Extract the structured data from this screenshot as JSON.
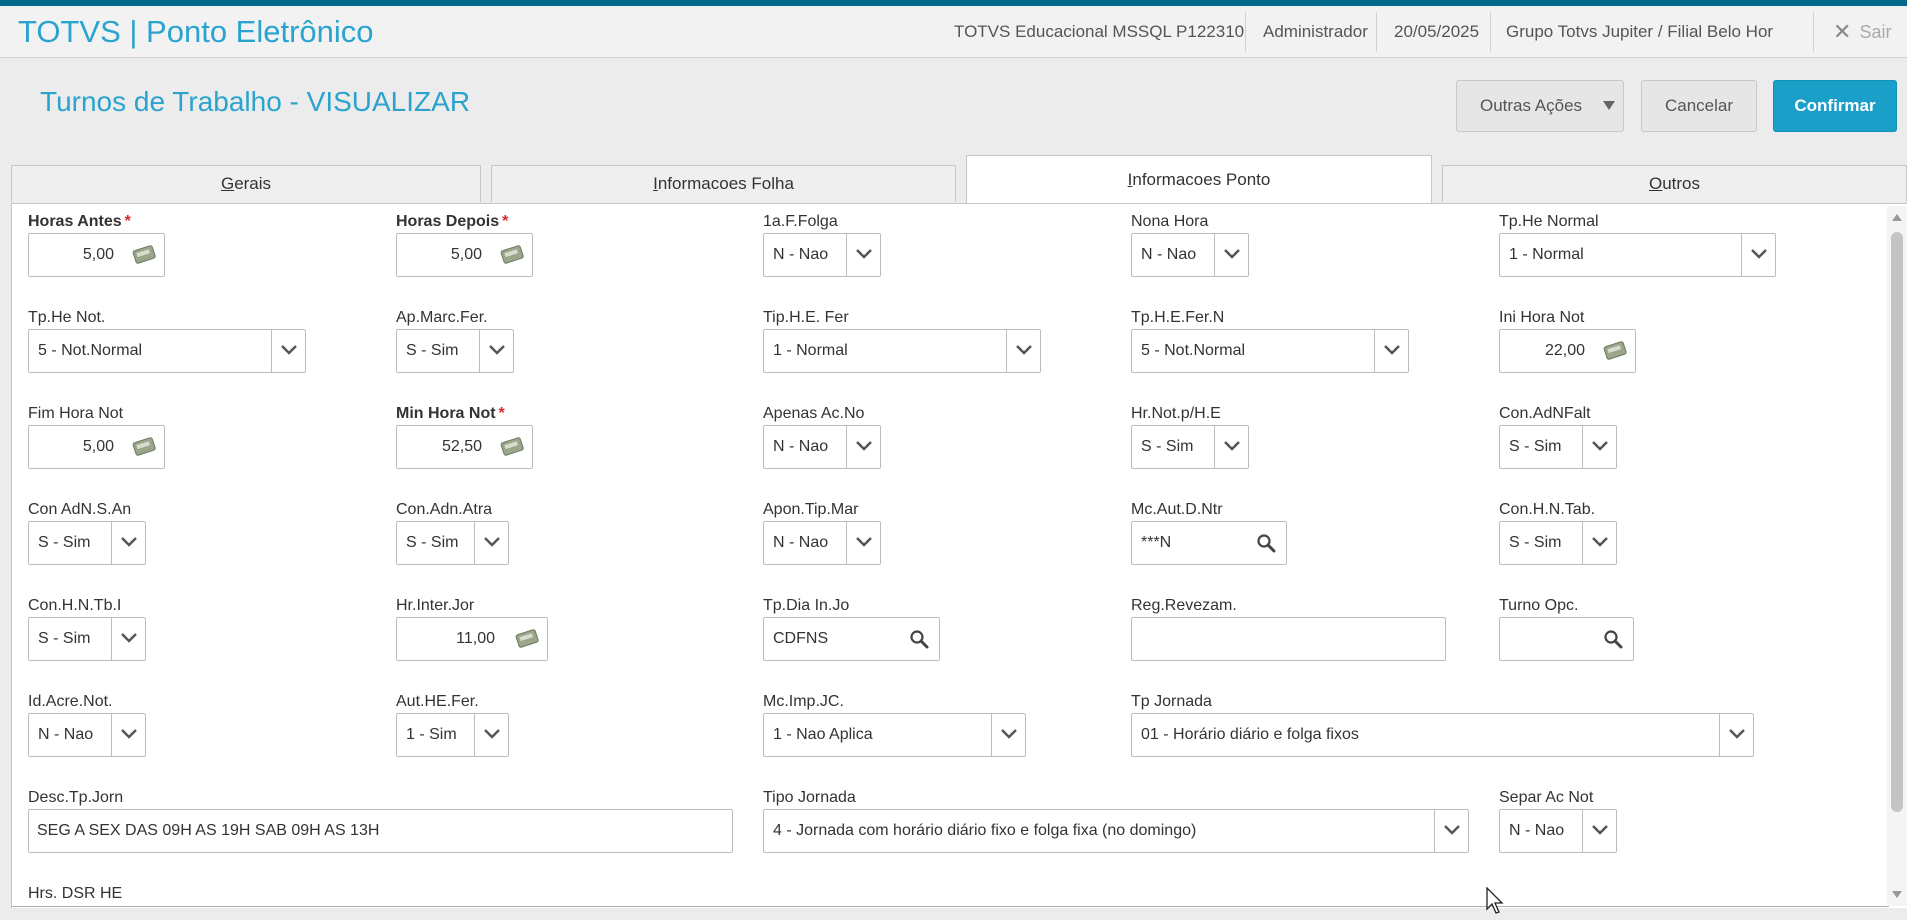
{
  "app": {
    "title": "TOTVS | Ponto Eletrônico"
  },
  "topbar": {
    "environment": "TOTVS Educacional MSSQL P122310",
    "user": "Administrador",
    "date": "20/05/2025",
    "branch": "Grupo Totvs Jupiter / Filial Belo Hor",
    "logout_label": "Sair"
  },
  "page": {
    "title": "Turnos de Trabalho - VISUALIZAR"
  },
  "actions": {
    "more": "Outras Ações",
    "cancel": "Cancelar",
    "confirm": "Confirmar"
  },
  "tabs": [
    "Gerais",
    "Informacoes Folha",
    "Informacoes Ponto",
    "Outros"
  ],
  "active_tab": "Informacoes Ponto",
  "fields": {
    "horas_antes": {
      "label": "Horas Antes",
      "value": "5,00",
      "required": true
    },
    "horas_depois": {
      "label": "Horas Depois",
      "value": "5,00",
      "required": true
    },
    "primeira_folga": {
      "label": "1a.F.Folga",
      "value": "N - Nao"
    },
    "nona_hora": {
      "label": "Nona Hora",
      "value": "N - Nao"
    },
    "tp_he_normal": {
      "label": "Tp.He Normal",
      "value": "1 - Normal"
    },
    "tp_he_not": {
      "label": "Tp.He Not.",
      "value": "5 - Not.Normal"
    },
    "ap_marc_fer": {
      "label": "Ap.Marc.Fer.",
      "value": "S - Sim"
    },
    "tip_he_fer": {
      "label": "Tip.H.E. Fer",
      "value": "1 - Normal"
    },
    "tp_he_fer_n": {
      "label": "Tp.H.E.Fer.N",
      "value": "5 - Not.Normal"
    },
    "ini_hora_not": {
      "label": "Ini Hora Not",
      "value": "22,00"
    },
    "fim_hora_not": {
      "label": "Fim Hora Not",
      "value": "5,00"
    },
    "min_hora_not": {
      "label": "Min Hora Not",
      "value": "52,50",
      "required": true
    },
    "apenas_ac_no": {
      "label": "Apenas Ac.No",
      "value": "N - Nao"
    },
    "hr_not_p_he": {
      "label": "Hr.Not.p/H.E",
      "value": "S - Sim"
    },
    "con_adnfalt": {
      "label": "Con.AdNFalt",
      "value": "S - Sim"
    },
    "con_adn_s_an": {
      "label": "Con AdN.S.An",
      "value": "S - Sim"
    },
    "con_adn_atra": {
      "label": "Con.Adn.Atra",
      "value": "S - Sim"
    },
    "apon_tip_mar": {
      "label": "Apon.Tip.Mar",
      "value": "N - Nao"
    },
    "mc_aut_d_ntr": {
      "label": "Mc.Aut.D.Ntr",
      "value": "***N"
    },
    "con_h_n_tab": {
      "label": "Con.H.N.Tab.",
      "value": "S - Sim"
    },
    "con_h_n_tb_i": {
      "label": "Con.H.N.Tb.I",
      "value": "S - Sim"
    },
    "hr_inter_jor": {
      "label": "Hr.Inter.Jor",
      "value": "11,00"
    },
    "tp_dia_in_jo": {
      "label": "Tp.Dia In.Jo",
      "value": "CDFNS"
    },
    "reg_revezam": {
      "label": "Reg.Revezam.",
      "value": ""
    },
    "turno_opc": {
      "label": "Turno Opc.",
      "value": ""
    },
    "id_acre_not": {
      "label": "Id.Acre.Not.",
      "value": "N - Nao"
    },
    "aut_he_fer": {
      "label": "Aut.HE.Fer.",
      "value": "1 - Sim"
    },
    "mc_imp_jc": {
      "label": "Mc.Imp.JC.",
      "value": "1 - Nao Aplica"
    },
    "tp_jornada": {
      "label": "Tp Jornada",
      "value": "01 - Horário diário e folga fixos"
    },
    "desc_tp_jorn": {
      "label": "Desc.Tp.Jorn",
      "value": "SEG A SEX DAS 09H AS 19H SAB 09H AS 13H"
    },
    "tipo_jornada": {
      "label": "Tipo Jornada",
      "value": "4 - Jornada com horário diário fixo e folga fixa (no domingo)"
    },
    "separ_ac_not": {
      "label": "Separ Ac Not",
      "value": "N - Nao"
    },
    "hrs_dsr_he": {
      "label": "Hrs. DSR HE"
    }
  },
  "colors": {
    "accent": "#2aa3cf",
    "primary_button": "#1a9fc9",
    "required": "#d9262c",
    "top_strip": "#00698a"
  },
  "icons": [
    "calculator-icon",
    "search-icon",
    "chevron-down-icon",
    "close-icon",
    "mouse-cursor-icon"
  ]
}
